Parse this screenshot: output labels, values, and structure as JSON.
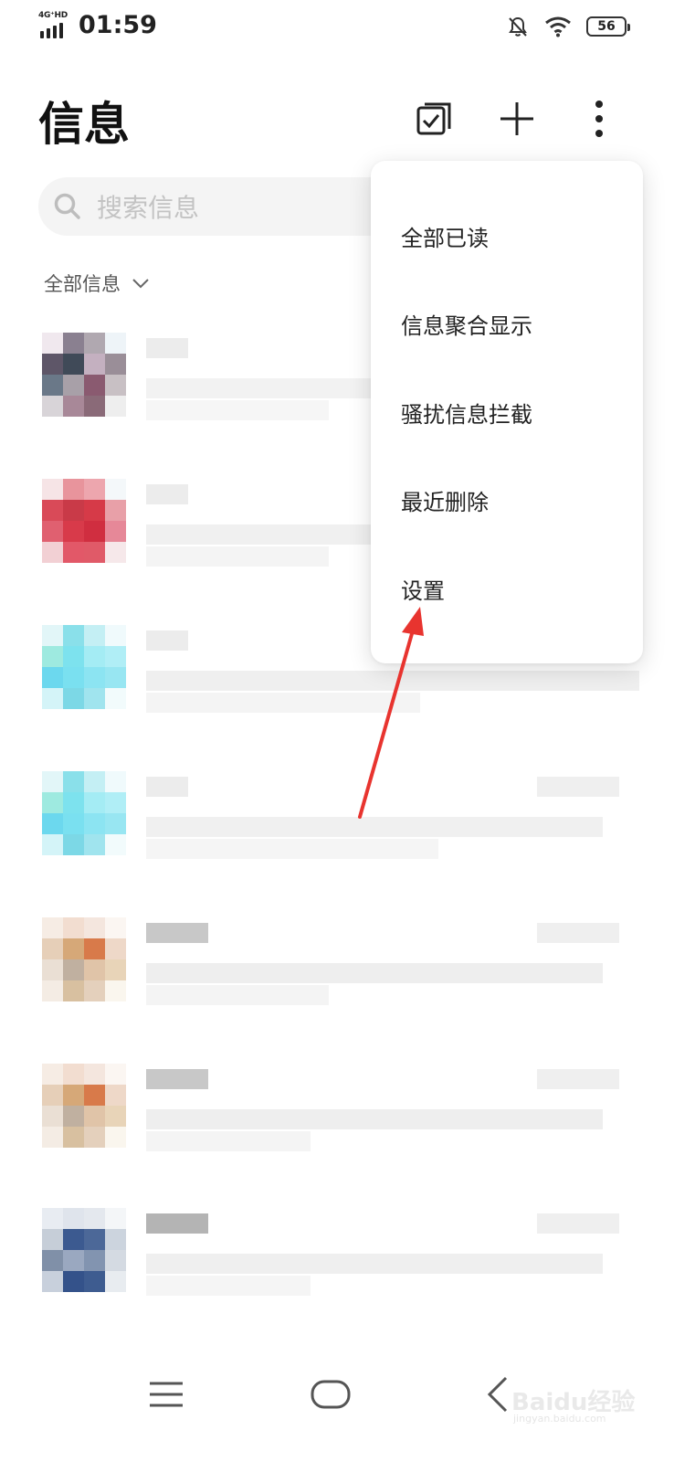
{
  "status_bar": {
    "network": "4G⁺HD",
    "time": "01:59",
    "battery": "56"
  },
  "header": {
    "title": "信息",
    "icons": [
      "select-icon",
      "add-icon",
      "more-icon"
    ]
  },
  "search": {
    "placeholder": "搜索信息"
  },
  "filter": {
    "label": "全部信息"
  },
  "menu": {
    "items": [
      {
        "label": "全部已读"
      },
      {
        "label": "信息聚合显示"
      },
      {
        "label": "骚扰信息拦截"
      },
      {
        "label": "最近删除"
      },
      {
        "label": "设置"
      }
    ]
  },
  "annotation": {
    "arrow_color": "#e8342f"
  },
  "nav_bar": {
    "icons": [
      "menu-icon",
      "home-icon",
      "back-icon"
    ]
  },
  "watermark": {
    "text": "Baidu经验",
    "sub": "jingyan.baidu.com"
  }
}
